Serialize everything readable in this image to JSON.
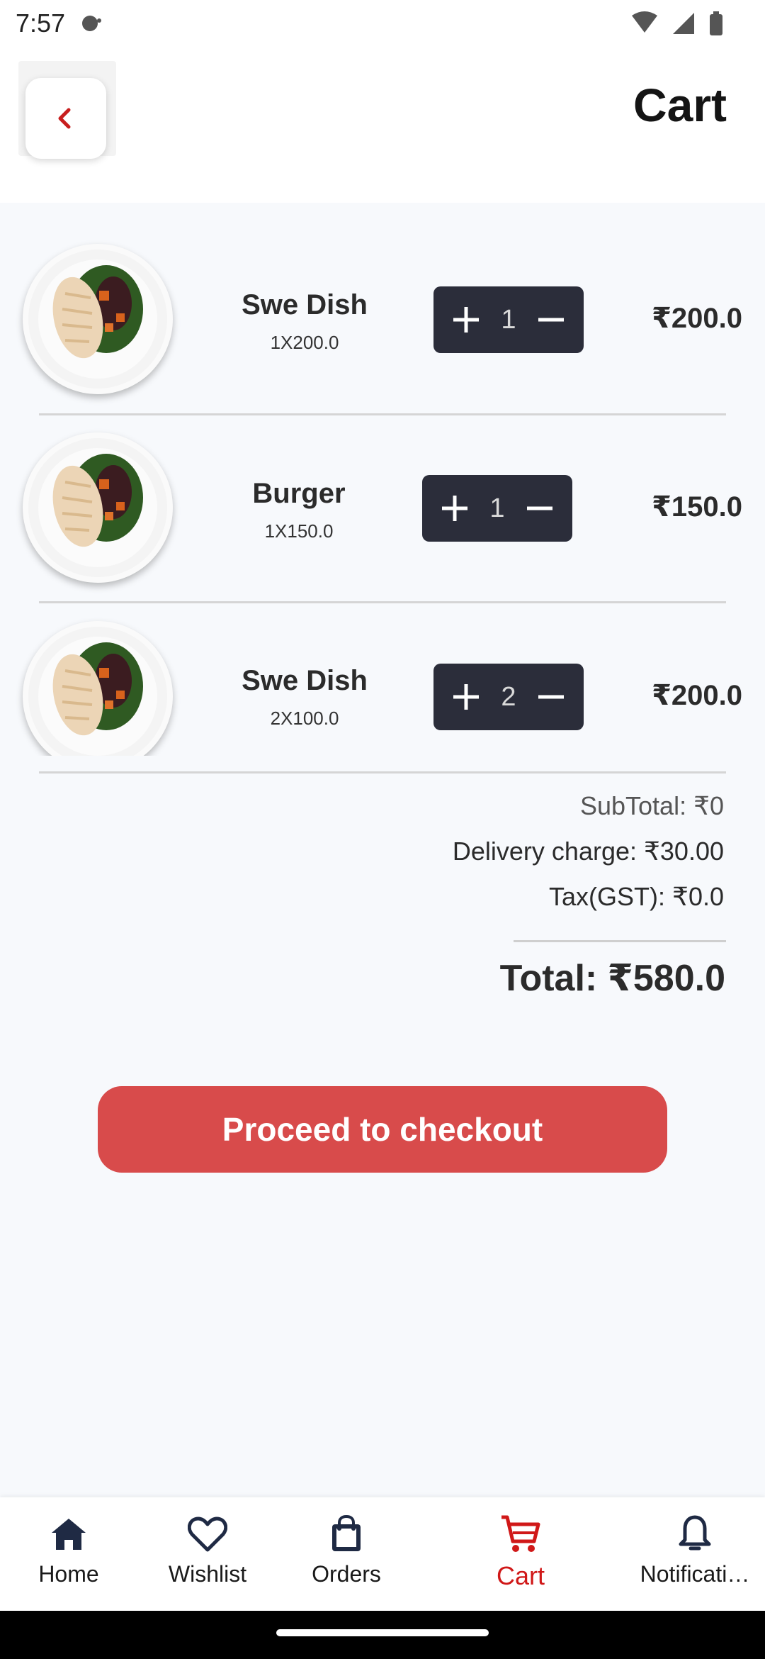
{
  "status_bar": {
    "time": "7:57"
  },
  "header": {
    "title": "Cart"
  },
  "cart": {
    "items": [
      {
        "name": "Swe Dish",
        "detail": "1X200.0",
        "quantity": "1",
        "price": "₹200.0"
      },
      {
        "name": "Burger",
        "detail": "1X150.0",
        "quantity": "1",
        "price": "₹150.0"
      },
      {
        "name": "Swe Dish",
        "detail": "2X100.0",
        "quantity": "2",
        "price": "₹200.0"
      }
    ]
  },
  "summary": {
    "subtotal": "SubTotal: ₹0",
    "delivery": "Delivery charge: ₹30.00",
    "tax": "Tax(GST): ₹0.0",
    "total": "Total: ₹580.0"
  },
  "checkout_label": "Proceed to checkout",
  "bottom_nav": {
    "items": [
      {
        "label": "Home",
        "icon": "home-icon"
      },
      {
        "label": "Wishlist",
        "icon": "heart-icon"
      },
      {
        "label": "Orders",
        "icon": "shopping-bag-icon"
      },
      {
        "label": "Cart",
        "icon": "cart-icon",
        "active": true
      },
      {
        "label": "Notificati…",
        "icon": "bell-icon"
      }
    ]
  },
  "colors": {
    "accent": "#d84b4b",
    "active_nav": "#d01818",
    "stepper": "#2b2d3a",
    "back_arrow": "#c81e1e"
  }
}
